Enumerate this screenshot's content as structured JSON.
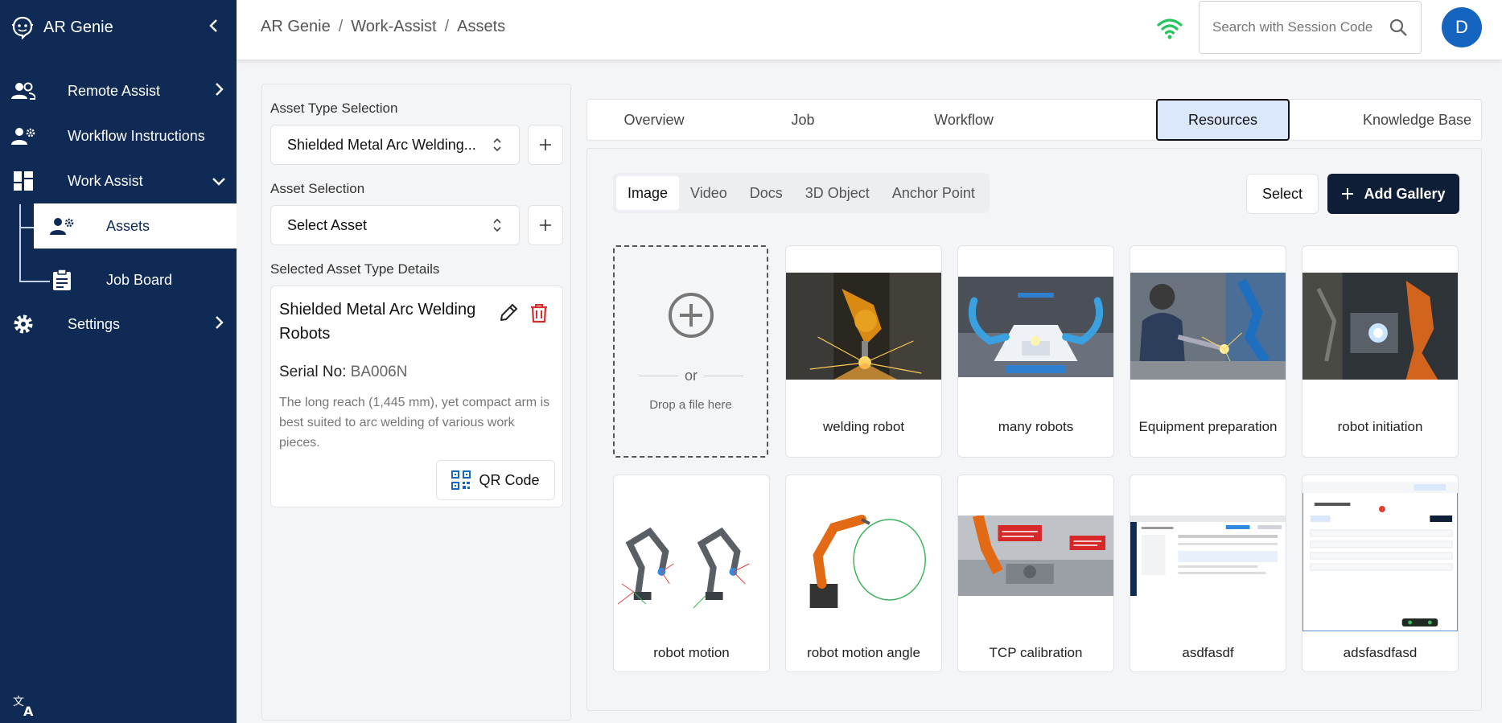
{
  "sidebar": {
    "brand": "AR Genie",
    "items": [
      {
        "label": "Remote Assist"
      },
      {
        "label": "Workflow Instructions"
      },
      {
        "label": "Work Assist"
      },
      {
        "label": "Assets"
      },
      {
        "label": "Job Board"
      },
      {
        "label": "Settings"
      }
    ]
  },
  "header": {
    "breadcrumb": [
      "AR Genie",
      "Work-Assist",
      "Assets"
    ],
    "search_placeholder": "Search with Session Code",
    "avatar_initial": "D"
  },
  "left_panel": {
    "asset_type_label": "Asset Type Selection",
    "asset_type_value": "Shielded Metal Arc Welding...",
    "asset_label": "Asset Selection",
    "asset_value": "Select Asset",
    "details_label": "Selected Asset Type Details",
    "details": {
      "title": "Shielded Metal Arc Welding Robots",
      "serial_label": "Serial No:",
      "serial_value": "BA006N",
      "description": "The long reach (1,445 mm), yet compact arm is best suited to arc welding of various work pieces.",
      "qr_label": "QR Code"
    }
  },
  "tabs": [
    "Overview",
    "Job",
    "Workflow",
    "Resources",
    "Knowledge Base"
  ],
  "active_tab": "Resources",
  "resources": {
    "subtabs": [
      "Image",
      "Video",
      "Docs",
      "3D Object",
      "Anchor Point"
    ],
    "active_subtab": "Image",
    "select_label": "Select",
    "add_gallery_label": "Add Gallery",
    "dropzone": {
      "or": "or",
      "text": "Drop a file here"
    },
    "gallery": [
      {
        "label": "welding robot"
      },
      {
        "label": "many robots"
      },
      {
        "label": "Equipment preparation"
      },
      {
        "label": "robot initiation"
      },
      {
        "label": "robot motion"
      },
      {
        "label": "robot motion angle"
      },
      {
        "label": "TCP calibration"
      },
      {
        "label": "asdfasdf"
      },
      {
        "label": "adsfasdfasd"
      }
    ]
  },
  "colors": {
    "sidebar_bg": "#0e2a55",
    "accent": "#1565c0",
    "active_tab_bg": "#dbe8fb",
    "primary_button": "#0e1e36",
    "delete": "#d32f2f",
    "wifi": "#22c55e"
  }
}
